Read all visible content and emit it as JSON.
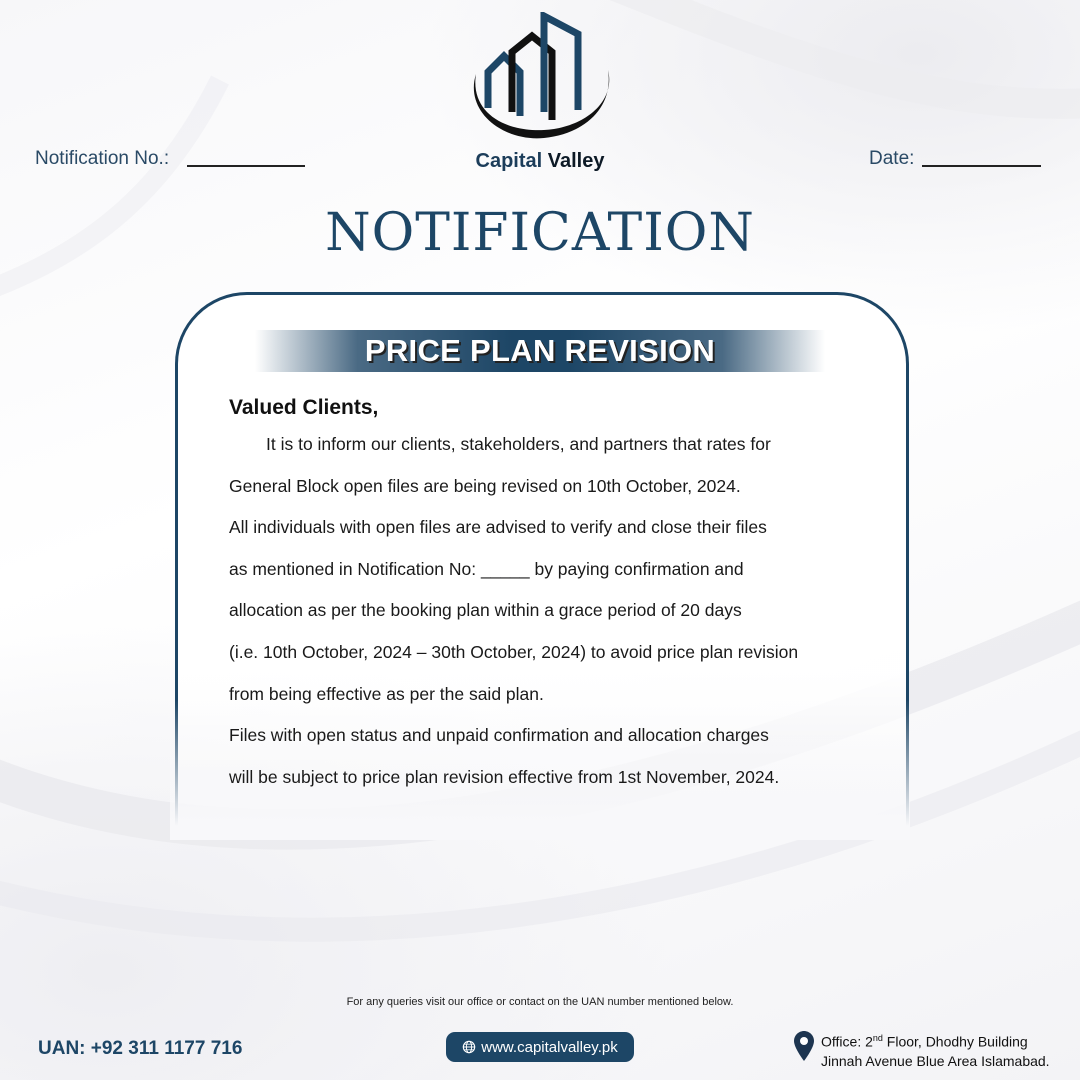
{
  "header": {
    "brand_word1": "Capital",
    "brand_word2": "Valley",
    "notification_no_label": "Notification No.:",
    "date_label": "Date:"
  },
  "title": "NOTIFICATION",
  "card": {
    "banner": "PRICE PLAN REVISION",
    "greeting": "Valued Clients,",
    "lines": [
      "It is to inform our clients, stakeholders, and partners that rates for",
      "General Block open files are being revised on 10th October, 2024.",
      "All individuals with open files are advised to verify and close their files",
      "as mentioned in Notification No: _____ by paying confirmation and",
      "allocation as per the booking plan within a grace period of 20 days",
      "(i.e. 10th October, 2024 – 30th October, 2024) to avoid price plan revision",
      "from being effective as per the said plan.",
      "Files with open status and unpaid confirmation and allocation charges",
      "will be subject to price plan revision effective from 1st November, 2024."
    ]
  },
  "footer": {
    "note": "For any queries visit our office or contact on the UAN number mentioned below.",
    "uan": "UAN: +92 311 1177 716",
    "website": "www.capitalvalley.pk",
    "office_line1_prefix": "Office: 2",
    "office_line1_sup": "nd",
    "office_line1_suffix": " Floor, Dhodhy Building",
    "office_line2": "Jinnah Avenue Blue Area Islamabad."
  },
  "colors": {
    "primary": "#1d4666",
    "text": "#1a1a1a"
  },
  "icons": [
    "capital-valley-logo",
    "globe-icon",
    "location-pin-icon"
  ]
}
